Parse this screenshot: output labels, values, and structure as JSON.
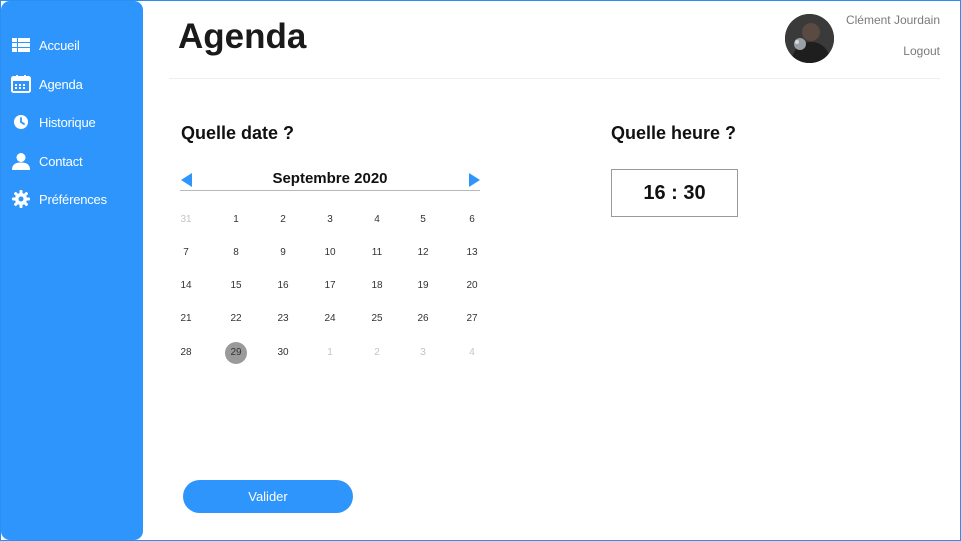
{
  "sidebar": {
    "items": [
      {
        "label": "Accueil",
        "icon": "home-list-icon"
      },
      {
        "label": "Agenda",
        "icon": "calendar-icon"
      },
      {
        "label": "Historique",
        "icon": "clock-icon"
      },
      {
        "label": "Contact",
        "icon": "person-icon"
      },
      {
        "label": "Préférences",
        "icon": "gear-icon"
      }
    ],
    "color": "#2d95fb"
  },
  "header": {
    "title": "Agenda",
    "user_name": "Clément Jourdain",
    "logout_label": "Logout"
  },
  "date_section": {
    "heading": "Quelle date ?",
    "month_label": "Septembre 2020",
    "weeks": [
      [
        {
          "d": "31",
          "muted": true
        },
        {
          "d": "1"
        },
        {
          "d": "2"
        },
        {
          "d": "3"
        },
        {
          "d": "4"
        },
        {
          "d": "5"
        },
        {
          "d": "6"
        }
      ],
      [
        {
          "d": "7"
        },
        {
          "d": "8"
        },
        {
          "d": "9"
        },
        {
          "d": "10"
        },
        {
          "d": "11"
        },
        {
          "d": "12"
        },
        {
          "d": "13"
        }
      ],
      [
        {
          "d": "14"
        },
        {
          "d": "15"
        },
        {
          "d": "16"
        },
        {
          "d": "17"
        },
        {
          "d": "18"
        },
        {
          "d": "19"
        },
        {
          "d": "20"
        }
      ],
      [
        {
          "d": "21"
        },
        {
          "d": "22"
        },
        {
          "d": "23"
        },
        {
          "d": "24"
        },
        {
          "d": "25"
        },
        {
          "d": "26"
        },
        {
          "d": "27"
        }
      ],
      [
        {
          "d": "28"
        },
        {
          "d": "29",
          "selected": true
        },
        {
          "d": "30"
        },
        {
          "d": "1",
          "muted": true
        },
        {
          "d": "2",
          "muted": true
        },
        {
          "d": "3",
          "muted": true
        },
        {
          "d": "4",
          "muted": true
        }
      ]
    ]
  },
  "time_section": {
    "heading": "Quelle heure ?",
    "value": "16 : 30"
  },
  "actions": {
    "validate_label": "Valider"
  }
}
